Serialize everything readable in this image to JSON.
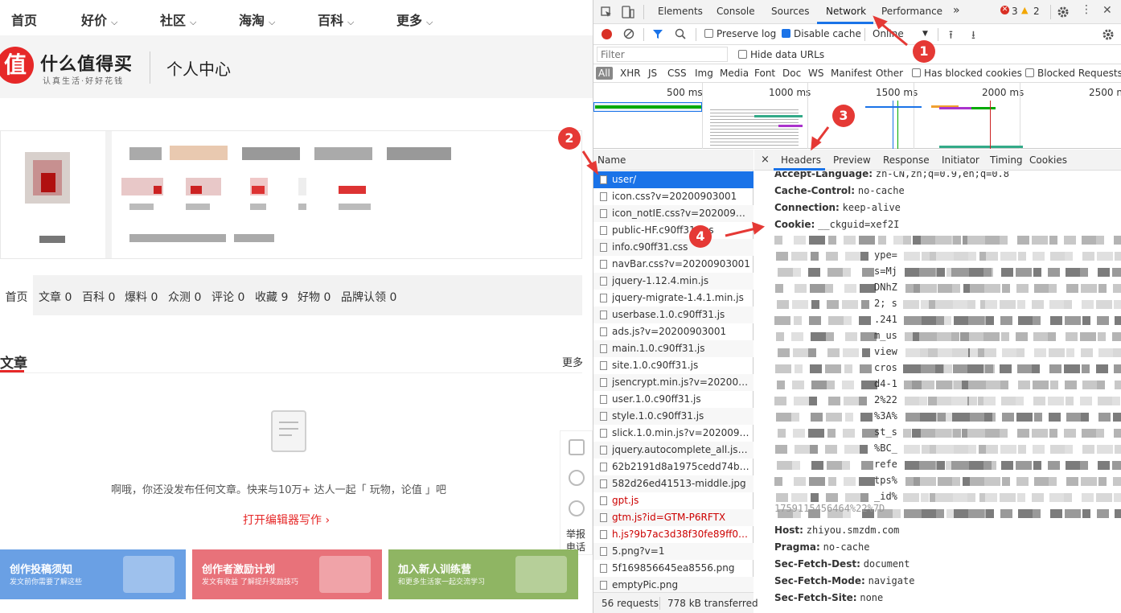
{
  "topnav": {
    "items": [
      {
        "label": "首页",
        "chevron": false
      },
      {
        "label": "好价",
        "chevron": true
      },
      {
        "label": "社区",
        "chevron": true
      },
      {
        "label": "海淘",
        "chevron": true
      },
      {
        "label": "百科",
        "chevron": true
      },
      {
        "label": "更多",
        "chevron": true
      }
    ],
    "chevron": "⌵"
  },
  "brand": {
    "logo_char": "值",
    "name": "什么值得买",
    "slogan": "认真生活·好好花钱",
    "page_title": "个人中心"
  },
  "profile_tabs": [
    "首页",
    "文章 0",
    "百科 0",
    "爆料 0",
    "众测 0",
    "评论 0",
    "收藏 9",
    "好物 0",
    "品牌认领 0"
  ],
  "articles": {
    "title": "文章",
    "more": "更多",
    "empty_text": "啊哦，你还没发布任何文章。快来与10万+ 达人一起「 玩物，论值 」吧",
    "editor_link": "打开编辑器写作 ›"
  },
  "side_tools": {
    "report": "举报\n电话"
  },
  "banners": [
    {
      "title": "创作投稿须知",
      "sub": "发文前你需要了解这些",
      "color": "#6aa0e4"
    },
    {
      "title": "创作者激励计划",
      "sub": "发文有收益 了解提升奖励技巧",
      "color": "#e8727a"
    },
    {
      "title": "加入新人训练营",
      "sub": "和更多生活家一起交流学习",
      "color": "#8fb563"
    }
  ],
  "devtools": {
    "tabs": [
      "Elements",
      "Console",
      "Sources",
      "Network",
      "Performance",
      "»"
    ],
    "active_tab": "Network",
    "errors": "3",
    "warnings": "2",
    "toolbar": {
      "preserve_log": "Preserve log",
      "disable_cache": "Disable cache",
      "throttle": "Online"
    },
    "filter": {
      "placeholder": "Filter",
      "hide_data_urls": "Hide data URLs"
    },
    "types": [
      "All",
      "XHR",
      "JS",
      "CSS",
      "Img",
      "Media",
      "Font",
      "Doc",
      "WS",
      "Manifest",
      "Other"
    ],
    "has_blocked_cookies": "Has blocked cookies",
    "blocked_requests": "Blocked Requests",
    "timeline_ticks": [
      "500 ms",
      "1000 ms",
      "1500 ms",
      "2000 ms",
      "2500 n"
    ],
    "name_header": "Name",
    "requests": [
      {
        "name": "user/",
        "selected": true,
        "red": false
      },
      {
        "name": "icon.css?v=20200903001",
        "selected": false,
        "red": false
      },
      {
        "name": "icon_notIE.css?v=20200903...",
        "selected": false,
        "red": false
      },
      {
        "name": "public-HF.c90ff31.css",
        "selected": false,
        "red": false
      },
      {
        "name": "info.c90ff31.css",
        "selected": false,
        "red": false
      },
      {
        "name": "navBar.css?v=20200903001",
        "selected": false,
        "red": false
      },
      {
        "name": "jquery-1.12.4.min.js",
        "selected": false,
        "red": false
      },
      {
        "name": "jquery-migrate-1.4.1.min.js",
        "selected": false,
        "red": false
      },
      {
        "name": "userbase.1.0.c90ff31.js",
        "selected": false,
        "red": false
      },
      {
        "name": "ads.js?v=20200903001",
        "selected": false,
        "red": false
      },
      {
        "name": "main.1.0.c90ff31.js",
        "selected": false,
        "red": false
      },
      {
        "name": "site.1.0.c90ff31.js",
        "selected": false,
        "red": false
      },
      {
        "name": "jsencrypt.min.js?v=20200903...",
        "selected": false,
        "red": false
      },
      {
        "name": "user.1.0.c90ff31.js",
        "selected": false,
        "red": false
      },
      {
        "name": "style.1.0.c90ff31.js",
        "selected": false,
        "red": false
      },
      {
        "name": "slick.1.0.min.js?v=20200903...",
        "selected": false,
        "red": false
      },
      {
        "name": "jquery.autocomplete_all.js?v...",
        "selected": false,
        "red": false
      },
      {
        "name": "62b2191d8a1975cedd74b8b...",
        "selected": false,
        "red": false
      },
      {
        "name": "582d26ed41513-middle.jpg",
        "selected": false,
        "red": false
      },
      {
        "name": "gpt.js",
        "selected": false,
        "red": true
      },
      {
        "name": "gtm.js?id=GTM-P6RFTX",
        "selected": false,
        "red": true
      },
      {
        "name": "h.js?9b7ac3d38f30fe89ff0b8...",
        "selected": false,
        "red": true
      },
      {
        "name": "5.png?v=1",
        "selected": false,
        "red": false
      },
      {
        "name": "5f169856645ea8556.png",
        "selected": false,
        "red": false
      },
      {
        "name": "emptyPic.png",
        "selected": false,
        "red": false
      }
    ],
    "summary": {
      "requests": "56 requests",
      "transferred": "778 kB transferred"
    },
    "detail_tabs": [
      "×",
      "Headers",
      "Preview",
      "Response",
      "Initiator",
      "Timing",
      "Cookies"
    ],
    "headers_top": [
      {
        "name": "Accept-Language:",
        "value": "zh-CN,zh;q=0.9,en;q=0.8"
      },
      {
        "name": "Cache-Control:",
        "value": "no-cache"
      },
      {
        "name": "Connection:",
        "value": "keep-alive"
      },
      {
        "name": "Cookie:",
        "value": "__ckguid=xef2I"
      }
    ],
    "cookie_fragments": [
      "ype=",
      "s=Mj",
      "DNhZ",
      "2; s",
      ".241",
      "m_us",
      "view",
      "cros",
      "d4-1",
      "2%22",
      "%3A%",
      "st_s",
      "%BC_",
      "refe",
      "tps%",
      "_id%"
    ],
    "cookie_tail": "1759115456464%22%7D",
    "headers_bottom": [
      {
        "name": "Host:",
        "value": "zhiyou.smzdm.com"
      },
      {
        "name": "Pragma:",
        "value": "no-cache"
      },
      {
        "name": "Sec-Fetch-Dest:",
        "value": "document"
      },
      {
        "name": "Sec-Fetch-Mode:",
        "value": "navigate"
      },
      {
        "name": "Sec-Fetch-Site:",
        "value": "none"
      }
    ],
    "annotations": [
      "1",
      "2",
      "3",
      "4"
    ]
  }
}
